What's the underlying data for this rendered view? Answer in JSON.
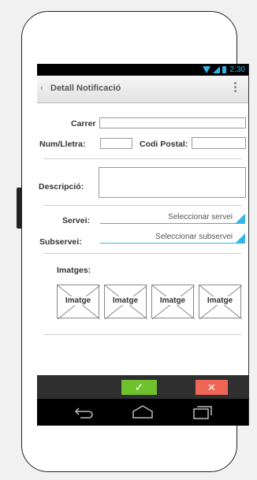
{
  "status_bar": {
    "time": "2:30"
  },
  "action_bar": {
    "title": "Detall Notificació",
    "back_glyph": "‹"
  },
  "form": {
    "carrer_label": "Carrer",
    "carrer_value": "",
    "num_lletra_label": "Num/Lletra:",
    "num_lletra_value": "",
    "codi_postal_label": "Codi Postal:",
    "codi_postal_value": "",
    "descripcio_label": "Descripció:",
    "descripcio_value": "",
    "servei_label": "Servei:",
    "servei_select": "Seleccionar servei",
    "subservei_label": "Subservei:",
    "subservei_select": "Seleccionar subservei",
    "imatges_label": "Imatges:",
    "image_placeholders": [
      "Imatge",
      "Imatge",
      "Imatge",
      "Imatge"
    ]
  },
  "buttons": {
    "ok": "✓",
    "cancel": "✕"
  },
  "colors": {
    "accent": "#33b5e5",
    "ok": "#6fc12d",
    "cancel": "#ee6655"
  },
  "icons": [
    "wifi-icon",
    "signal-icon",
    "battery-icon",
    "back-chevron-icon",
    "overflow-menu-icon",
    "nav-back-icon",
    "nav-home-icon",
    "nav-recents-icon"
  ]
}
